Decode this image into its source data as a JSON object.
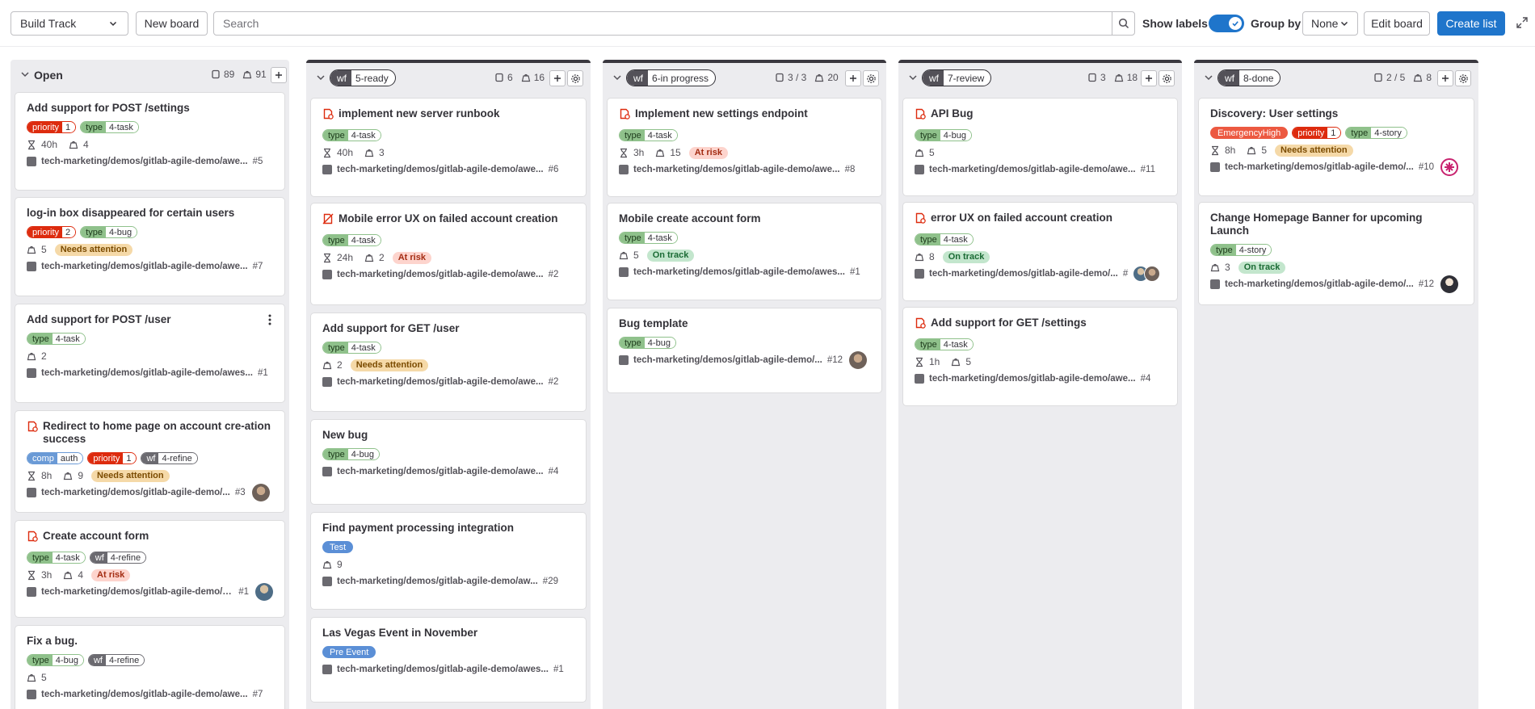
{
  "toolbar": {
    "board_select": "Build Track",
    "new_board": "New board",
    "search_placeholder": "Search",
    "show_labels": "Show labels",
    "group_by": "Group by",
    "group_by_value": "None",
    "edit_board": "Edit board",
    "create_list": "Create list"
  },
  "lists": [
    {
      "title": "Open",
      "issue_count": "89",
      "weight": "91",
      "cards": [
        {
          "title": "Add support for POST /settings",
          "labels": [
            [
              "priority",
              "1",
              "red"
            ],
            [
              "type",
              "4-task",
              "green"
            ]
          ],
          "time": "40h",
          "weight": "4",
          "status": "",
          "path": "tech-marketing/demos/gitlab-agile-demo/awe...",
          "num": "#5"
        },
        {
          "title": "log-in box disappeared for certain users",
          "labels": [
            [
              "priority",
              "2",
              "red"
            ],
            [
              "type",
              "4-bug",
              "green"
            ]
          ],
          "time": "",
          "weight": "5",
          "status": "Needs attention",
          "path": "tech-marketing/demos/gitlab-agile-demo/awe...",
          "num": "#7"
        },
        {
          "title": "Add support for POST /user",
          "labels": [
            [
              "type",
              "4-task",
              "green"
            ]
          ],
          "time": "",
          "weight": "2",
          "status": "",
          "path": "tech-marketing/demos/gitlab-agile-demo/awes...",
          "num": "#1"
        },
        {
          "title": "Redirect to home page on account cre-ation success",
          "labels": [
            [
              "comp",
              "auth",
              "blue"
            ],
            [
              "priority",
              "1",
              "red"
            ],
            [
              "wf",
              "4-refine",
              "gray"
            ]
          ],
          "time": "8h",
          "weight": "9",
          "status": "Needs attention",
          "path": "tech-marketing/demos/gitlab-agile-demo/...",
          "num": "#3"
        },
        {
          "title": "Create account form",
          "labels": [
            [
              "type",
              "4-task",
              "green"
            ],
            [
              "wf",
              "4-refine",
              "gray"
            ]
          ],
          "time": "3h",
          "weight": "4",
          "status": "At risk",
          "path": "tech-marketing/demos/gitlab-agile-demo/a...",
          "num": "#1"
        },
        {
          "title": "Fix a bug.",
          "labels": [
            [
              "type",
              "4-bug",
              "green"
            ],
            [
              "wf",
              "4-refine",
              "gray"
            ]
          ],
          "time": "",
          "weight": "5",
          "status": "",
          "path": "tech-marketing/demos/gitlab-agile-demo/awe...",
          "num": "#7"
        }
      ]
    },
    {
      "badge_key": "wf",
      "badge_value": "5-ready",
      "issue_count": "6",
      "weight": "16",
      "cards": [
        {
          "title": "implement new server runbook",
          "labels": [
            [
              "type",
              "4-task",
              "green"
            ]
          ],
          "time": "40h",
          "weight": "3",
          "status": "",
          "path": "tech-marketing/demos/gitlab-agile-demo/awe...",
          "num": "#6"
        },
        {
          "title": "Mobile error UX on failed account creation",
          "labels": [
            [
              "type",
              "4-task",
              "green"
            ]
          ],
          "time": "24h",
          "weight": "2",
          "status": "At risk",
          "path": "tech-marketing/demos/gitlab-agile-demo/awe...",
          "num": "#2"
        },
        {
          "title": "Add support for GET /user",
          "labels": [
            [
              "type",
              "4-task",
              "green"
            ]
          ],
          "time": "",
          "weight": "2",
          "status": "Needs attention",
          "path": "tech-marketing/demos/gitlab-agile-demo/awe...",
          "num": "#2"
        },
        {
          "title": "New bug",
          "labels": [
            [
              "type",
              "4-bug",
              "green"
            ]
          ],
          "path": "tech-marketing/demos/gitlab-agile-demo/awe...",
          "num": "#4"
        },
        {
          "title": "Find payment processing integration",
          "solid_label": "Test",
          "weight": "9",
          "path": "tech-marketing/demos/gitlab-agile-demo/aw...",
          "num": "#29"
        },
        {
          "title": "Las Vegas Event in November",
          "solid_label": "Pre Event",
          "path": "tech-marketing/demos/gitlab-agile-demo/awes...",
          "num": "#1"
        }
      ]
    },
    {
      "badge_key": "wf",
      "badge_value": "6-in progress",
      "issue_count": "3 / 3",
      "weight": "20",
      "cards": [
        {
          "title": "Implement new settings endpoint",
          "labels": [
            [
              "type",
              "4-task",
              "green"
            ]
          ],
          "time": "3h",
          "weight": "15",
          "status": "At risk",
          "path": "tech-marketing/demos/gitlab-agile-demo/awe...",
          "num": "#8"
        },
        {
          "title": "Mobile create account form",
          "labels": [
            [
              "type",
              "4-task",
              "green"
            ]
          ],
          "weight": "5",
          "status": "On track",
          "path": "tech-marketing/demos/gitlab-agile-demo/awes...",
          "num": "#1"
        },
        {
          "title": "Bug template",
          "labels": [
            [
              "type",
              "4-bug",
              "green"
            ]
          ],
          "path": "tech-marketing/demos/gitlab-agile-demo/...",
          "num": "#12"
        }
      ]
    },
    {
      "badge_key": "wf",
      "badge_value": "7-review",
      "issue_count": "3",
      "weight": "18",
      "cards": [
        {
          "title": "API Bug",
          "labels": [
            [
              "type",
              "4-bug",
              "green"
            ]
          ],
          "weight": "5",
          "path": "tech-marketing/demos/gitlab-agile-demo/awe...",
          "num": "#11"
        },
        {
          "title": "error UX on failed account creation",
          "labels": [
            [
              "type",
              "4-task",
              "green"
            ]
          ],
          "weight": "8",
          "status": "On track",
          "path": "tech-marketing/demos/gitlab-agile-demo/...",
          "num": "#"
        },
        {
          "title": "Add support for GET /settings",
          "labels": [
            [
              "type",
              "4-task",
              "green"
            ]
          ],
          "time": "1h",
          "weight": "5",
          "path": "tech-marketing/demos/gitlab-agile-demo/awe...",
          "num": "#4"
        }
      ]
    },
    {
      "badge_key": "wf",
      "badge_value": "8-done",
      "issue_count": "2 / 5",
      "weight": "8",
      "cards": [
        {
          "title": "Discovery: User settings",
          "solid_red": "EmergencyHigh",
          "labels": [
            [
              "priority",
              "1",
              "red"
            ],
            [
              "type",
              "4-story",
              "green"
            ]
          ],
          "time": "8h",
          "weight": "5",
          "status": "Needs attention",
          "path": "tech-marketing/demos/gitlab-agile-demo/...",
          "num": "#10"
        },
        {
          "title": "Change Homepage Banner for upcoming Launch",
          "labels": [
            [
              "type",
              "4-story",
              "green"
            ]
          ],
          "weight": "3",
          "status": "On track",
          "path": "tech-marketing/demos/gitlab-agile-demo/...",
          "num": "#12"
        }
      ]
    }
  ],
  "colors": {
    "accent": "#1f75cb",
    "priority": "#dd2b0e",
    "type": "#8fc18b",
    "wf": "#6b6a70",
    "comp": "#6a9ad6"
  },
  "icons": [
    "chevron-down-icon",
    "search-icon",
    "check-icon",
    "issue-icon",
    "weight-icon",
    "hourglass-icon",
    "plus-icon",
    "gear-icon",
    "expand-icon",
    "kebab-icon",
    "issue-type-icon",
    "project-icon"
  ]
}
